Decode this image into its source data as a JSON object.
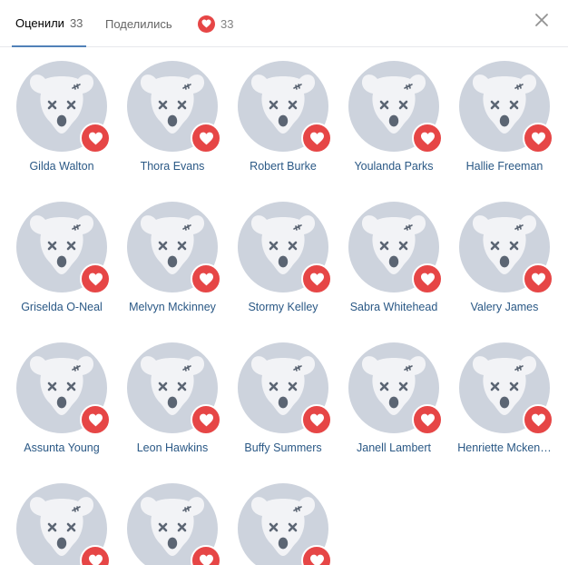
{
  "header": {
    "tab_liked_label": "Оценили",
    "tab_liked_count": "33",
    "tab_shared_label": "Поделились",
    "tab_hearts_count": "33"
  },
  "colors": {
    "accent": "#5181b8",
    "heart": "#e64646",
    "avatar_bg": "#cdd3dd",
    "link": "#2a5885"
  },
  "icons": {
    "close": "close-icon",
    "heart": "heart-icon",
    "avatar": "deactivated-dog-avatar-icon"
  },
  "users": [
    {
      "name": "Gilda Walton"
    },
    {
      "name": "Thora Evans"
    },
    {
      "name": "Robert Burke"
    },
    {
      "name": "Youlanda Parks"
    },
    {
      "name": "Hallie Freeman"
    },
    {
      "name": "Griselda O-Neal"
    },
    {
      "name": "Melvyn Mckinney"
    },
    {
      "name": "Stormy Kelley"
    },
    {
      "name": "Sabra Whitehead"
    },
    {
      "name": "Valery James"
    },
    {
      "name": "Assunta Young"
    },
    {
      "name": "Leon Hawkins"
    },
    {
      "name": "Buffy Summers"
    },
    {
      "name": "Janell Lambert"
    },
    {
      "name": "Henriette Mcken…"
    },
    {
      "name": ""
    },
    {
      "name": ""
    },
    {
      "name": ""
    }
  ]
}
